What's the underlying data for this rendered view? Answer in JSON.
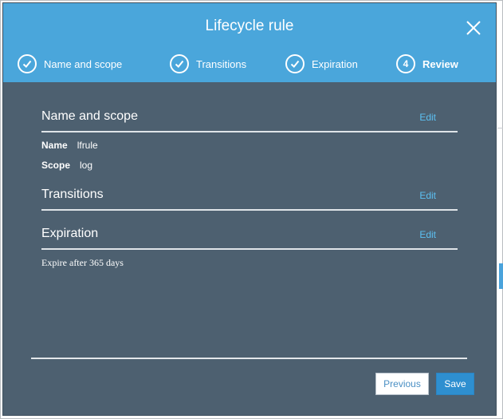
{
  "modal": {
    "title": "Lifecycle rule",
    "close_icon": "close-icon"
  },
  "steps": [
    {
      "label": "Name and scope",
      "state": "completed",
      "icon": "check-circle-icon"
    },
    {
      "label": "Transitions",
      "state": "completed",
      "icon": "check-circle-icon"
    },
    {
      "label": "Expiration",
      "state": "completed",
      "icon": "check-circle-icon"
    },
    {
      "label": "Review",
      "state": "active",
      "number": "4"
    }
  ],
  "sections": {
    "name_scope": {
      "title": "Name and scope",
      "edit_label": "Edit",
      "fields": [
        {
          "key": "Name",
          "value": "lfrule"
        },
        {
          "key": "Scope",
          "value": "log"
        }
      ]
    },
    "transitions": {
      "title": "Transitions",
      "edit_label": "Edit"
    },
    "expiration": {
      "title": "Expiration",
      "edit_label": "Edit",
      "summary": "Expire after 365 days"
    }
  },
  "footer": {
    "previous_label": "Previous",
    "save_label": "Save"
  },
  "colors": {
    "header": "#4aa6db",
    "body": "#4d6070",
    "link": "#5cc0f2",
    "primary_button": "#2e8fd0"
  }
}
